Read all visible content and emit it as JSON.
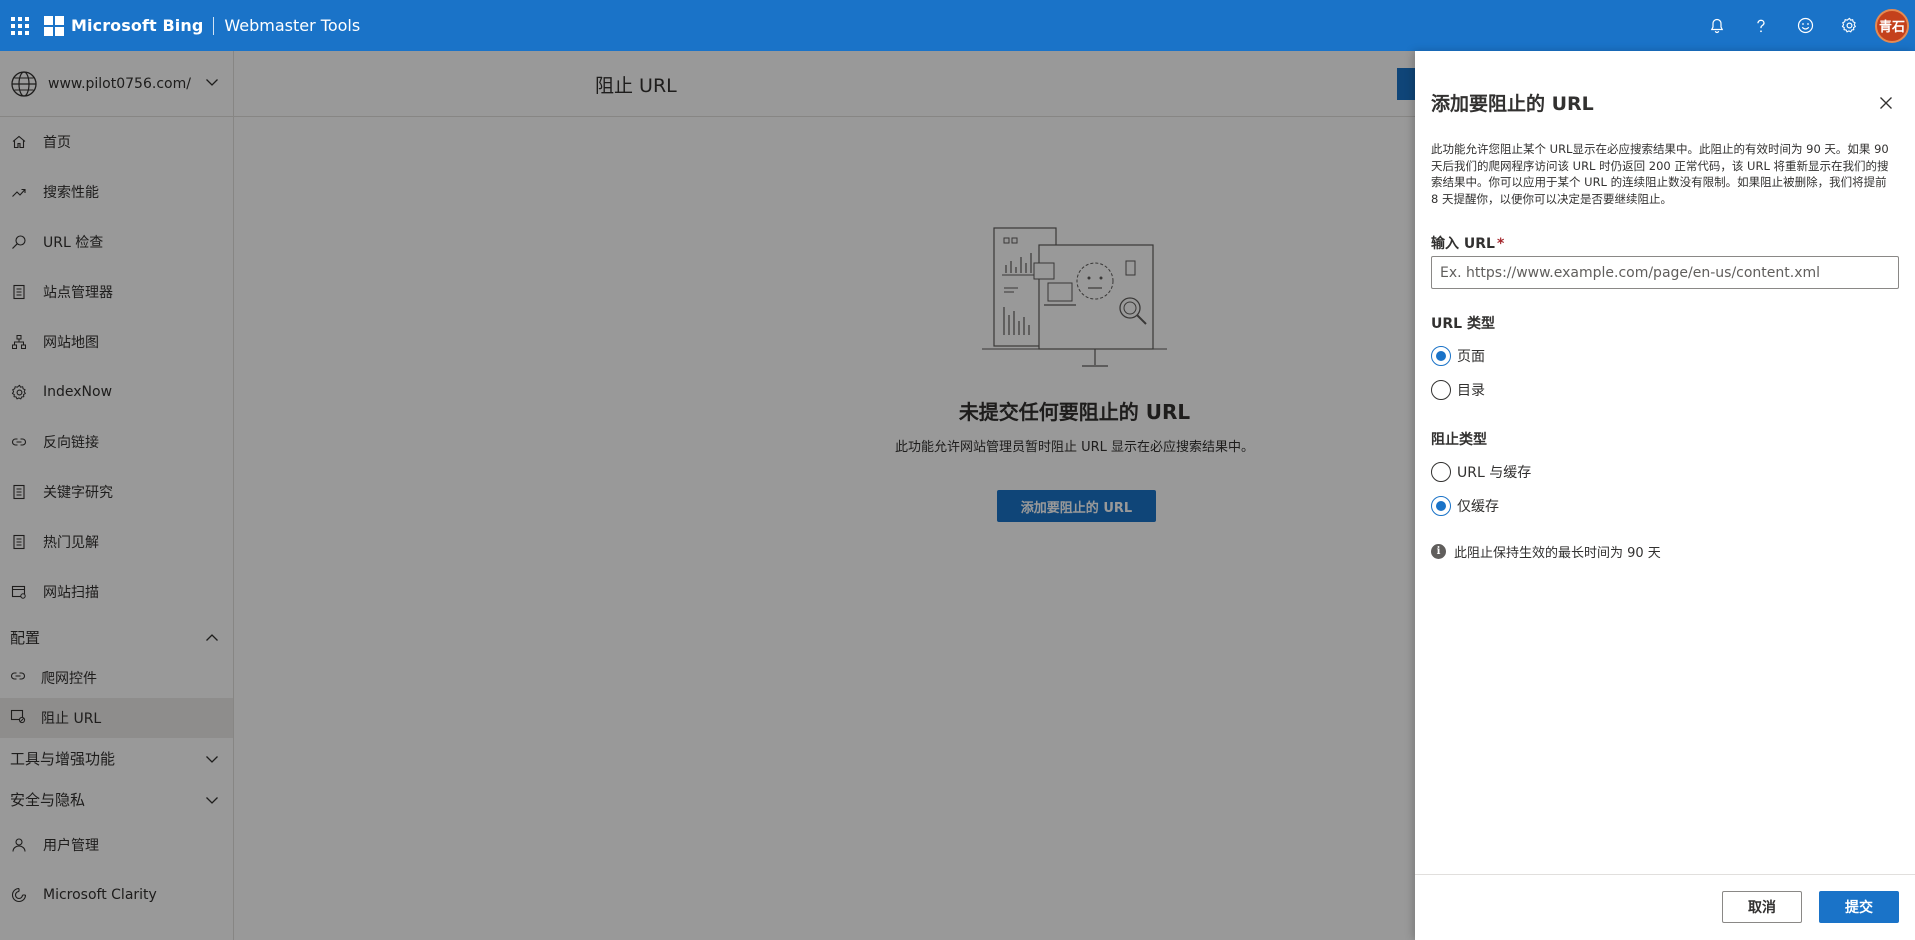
{
  "topbar": {
    "brand": "Microsoft Bing",
    "product": "Webmaster Tools",
    "avatar_text": "青石",
    "icons": [
      "waffle-icon",
      "bell-icon",
      "help-icon",
      "feedback-smiley-icon",
      "settings-gear-icon"
    ]
  },
  "sidebar": {
    "site": "www.pilot0756.com/",
    "items": [
      {
        "label": "首页",
        "icon": "home-icon"
      },
      {
        "label": "搜索性能",
        "icon": "trend-icon"
      },
      {
        "label": "URL 检查",
        "icon": "search-icon"
      },
      {
        "label": "站点管理器",
        "icon": "document-icon"
      },
      {
        "label": "网站地图",
        "icon": "sitemap-icon"
      },
      {
        "label": "IndexNow",
        "icon": "gear-icon"
      },
      {
        "label": "反向链接",
        "icon": "link-icon"
      },
      {
        "label": "关键字研究",
        "icon": "document-icon"
      },
      {
        "label": "热门见解",
        "icon": "document-icon"
      },
      {
        "label": "网站扫描",
        "icon": "scan-icon"
      }
    ],
    "config_section": "配置",
    "config_items": [
      {
        "label": "爬网控件",
        "icon": "link-icon"
      },
      {
        "label": "阻止 URL",
        "icon": "block-url-icon"
      }
    ],
    "tools_section": "工具与增强功能",
    "security_section": "安全与隐私",
    "bottom_items": [
      {
        "label": "用户管理",
        "icon": "user-icon"
      },
      {
        "label": "Microsoft Clarity",
        "icon": "clarity-icon"
      }
    ]
  },
  "main": {
    "title": "阻止 URL",
    "empty_title": "未提交任何要阻止的 URL",
    "empty_desc": "此功能允许网站管理员暂时阻止 URL 显示在必应搜索结果中。",
    "empty_button": "添加要阻止的 URL"
  },
  "panel": {
    "title": "添加要阻止的 URL",
    "description": "此功能允许您阻止某个 URL显示在必应搜索结果中。此阻止的有效时间为 90 天。如果 90 天后我们的爬网程序访问该 URL 时仍返回 200 正常代码，该 URL 将重新显示在我们的搜索结果中。你可以应用于某个 URL 的连续阻止数没有限制。如果阻止被删除，我们将提前 8 天提醒你，以便你可以决定是否要继续阻止。",
    "url_label": "输入 URL",
    "url_required": "*",
    "url_placeholder": "Ex. https://www.example.com/page/en-us/content.xml",
    "url_value": "",
    "url_type_label": "URL 类型",
    "url_type_options": [
      {
        "label": "页面",
        "checked": true
      },
      {
        "label": "目录",
        "checked": false
      }
    ],
    "block_type_label": "阻止类型",
    "block_type_options": [
      {
        "label": "URL 与缓存",
        "checked": false
      },
      {
        "label": "仅缓存",
        "checked": true
      }
    ],
    "info_text": "此阻止保持生效的最长时间为 90 天",
    "cancel_label": "取消",
    "submit_label": "提交"
  },
  "colors": {
    "accent": "#1a73c8",
    "avatar": "#c4411c"
  }
}
